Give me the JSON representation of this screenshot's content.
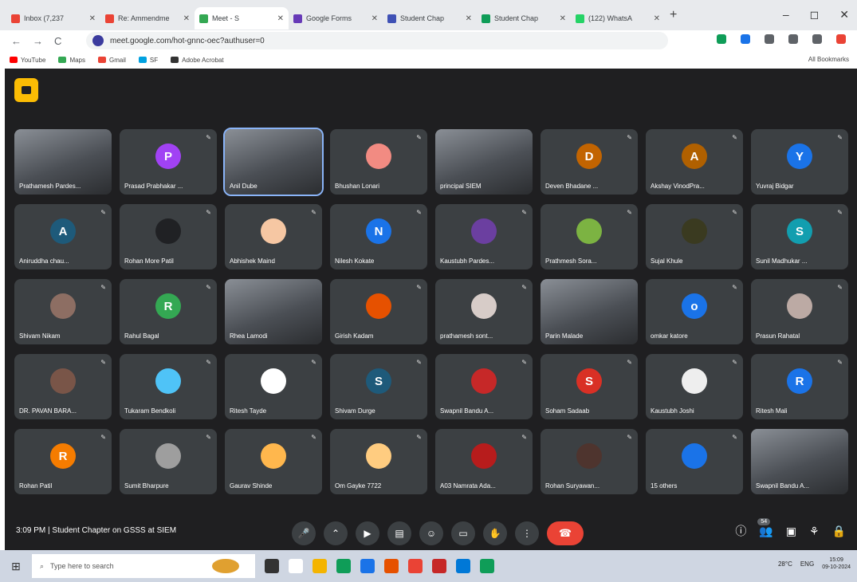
{
  "browser": {
    "tabs": [
      {
        "label": "Inbox (7,237",
        "icon_color": "#ea4335",
        "active": false
      },
      {
        "label": "Re: Ammendme",
        "icon_color": "#ea4335",
        "active": false
      },
      {
        "label": "Meet - S",
        "icon_color": "#34a853",
        "active": true
      },
      {
        "label": "Google Forms",
        "icon_color": "#673ab7",
        "active": false
      },
      {
        "label": "Student Chap",
        "icon_color": "#3f51b5",
        "active": false
      },
      {
        "label": "Student Chap",
        "icon_color": "#0f9d58",
        "active": false
      },
      {
        "label": "(122) WhatsA",
        "icon_color": "#25d366",
        "active": false
      }
    ],
    "new_tab": "+",
    "window_controls": [
      "–",
      "◻",
      "✕"
    ],
    "url": "meet.google.com/hot-gnnc-oec?authuser=0",
    "nav": {
      "back": "←",
      "forward": "→",
      "reload": "C"
    },
    "bookmarks": [
      {
        "label": "YouTube",
        "color": "#ff0000"
      },
      {
        "label": "Maps",
        "color": "#34a853"
      },
      {
        "label": "Gmail",
        "color": "#ea4335"
      },
      {
        "label": "SF",
        "color": "#00a1e0"
      },
      {
        "label": "Adobe Acrobat",
        "color": "#333333"
      }
    ],
    "all_bookmarks": "All Bookmarks",
    "extension_colors": [
      "#0f9d58",
      "#1a73e8",
      "#5f6368",
      "#5f6368",
      "#5f6368",
      "#ea4335"
    ]
  },
  "meet": {
    "participants": [
      {
        "name": "Prathamesh Pardes...",
        "avatar": "",
        "color": "",
        "video": true
      },
      {
        "name": "Prasad Prabhakar ...",
        "avatar": "P",
        "color": "#a142f4",
        "video": false
      },
      {
        "name": "Anil Dube",
        "avatar": "",
        "color": "",
        "video": true,
        "highlight": true
      },
      {
        "name": "Bhushan Lonari",
        "avatar": "",
        "color": "#f28b82",
        "video": false
      },
      {
        "name": "principal SIEM",
        "avatar": "",
        "color": "",
        "video": true
      },
      {
        "name": "Deven Bhadane ...",
        "avatar": "D",
        "color": "#c26401",
        "video": false
      },
      {
        "name": "Akshay VinodPra...",
        "avatar": "A",
        "color": "#b06000",
        "video": false
      },
      {
        "name": "Yuvraj Bidgar",
        "avatar": "Y",
        "color": "#1a73e8",
        "video": false
      },
      {
        "name": "Aniruddha chau...",
        "avatar": "A",
        "color": "#1e5a7a",
        "video": false
      },
      {
        "name": "Rohan More Patil",
        "avatar": "",
        "color": "#202124",
        "video": false
      },
      {
        "name": "Abhishek Maind",
        "avatar": "",
        "color": "#f6c7a3",
        "video": false
      },
      {
        "name": "Nilesh Kokate",
        "avatar": "N",
        "color": "#1a73e8",
        "video": false
      },
      {
        "name": "Kaustubh Pardes...",
        "avatar": "",
        "color": "#6b3fa0",
        "video": false
      },
      {
        "name": "Prathmesh Sora...",
        "avatar": "",
        "color": "#7cb342",
        "video": false
      },
      {
        "name": "Sujal Khule",
        "avatar": "",
        "color": "#3a3a20",
        "video": false
      },
      {
        "name": "Sunil Madhukar ...",
        "avatar": "S",
        "color": "#129eaf",
        "video": false
      },
      {
        "name": "Shivam Nikam",
        "avatar": "",
        "color": "#8d6e63",
        "video": false
      },
      {
        "name": "Rahul Bagal",
        "avatar": "R",
        "color": "#34a853",
        "video": false
      },
      {
        "name": "Rhea Lamodi",
        "avatar": "",
        "color": "",
        "video": true
      },
      {
        "name": "Girish Kadam",
        "avatar": "",
        "color": "#e65100",
        "video": false
      },
      {
        "name": "prathamesh sont...",
        "avatar": "",
        "color": "#d7ccc8",
        "video": false
      },
      {
        "name": "Parin Malade",
        "avatar": "",
        "color": "",
        "video": true
      },
      {
        "name": "omkar katore",
        "avatar": "o",
        "color": "#1a73e8",
        "video": false
      },
      {
        "name": "Prasun Rahatal",
        "avatar": "",
        "color": "#bcaaa4",
        "video": false
      },
      {
        "name": "DR. PAVAN BARA...",
        "avatar": "",
        "color": "#795548",
        "video": false
      },
      {
        "name": "Tukaram Bendkoli",
        "avatar": "",
        "color": "#4fc3f7",
        "video": false
      },
      {
        "name": "Ritesh Tayde",
        "avatar": "",
        "color": "#ffffff",
        "video": false
      },
      {
        "name": "Shivam Durge",
        "avatar": "S",
        "color": "#1e5a7a",
        "video": false
      },
      {
        "name": "Swapnil Bandu A...",
        "avatar": "",
        "color": "#c62828",
        "video": false
      },
      {
        "name": "Soham Sadaab",
        "avatar": "S",
        "color": "#d93025",
        "video": false
      },
      {
        "name": "Kaustubh Joshi",
        "avatar": "",
        "color": "#eeeeee",
        "video": false
      },
      {
        "name": "Ritesh Mali",
        "avatar": "R",
        "color": "#1a73e8",
        "video": false
      },
      {
        "name": "Rohan Patil",
        "avatar": "R",
        "color": "#f57c00",
        "video": false
      },
      {
        "name": "Sumit Bharpure",
        "avatar": "",
        "color": "#9e9e9e",
        "video": false
      },
      {
        "name": "Gaurav Shinde",
        "avatar": "",
        "color": "#ffb74d",
        "video": false
      },
      {
        "name": "Om Gayke 7722",
        "avatar": "",
        "color": "#ffcc80",
        "video": false
      },
      {
        "name": "A03 Namrata Ada...",
        "avatar": "",
        "color": "#b71c1c",
        "video": false
      },
      {
        "name": "Rohan Suryawan...",
        "avatar": "",
        "color": "#4e342e",
        "video": false
      },
      {
        "name": "15 others",
        "avatar": "",
        "color": "#1a73e8",
        "video": false
      },
      {
        "name": "Swapnil Bandu A...",
        "avatar": "",
        "color": "",
        "video": true
      }
    ],
    "mic_glyph": "✎",
    "bottom": {
      "time": "3:09 PM",
      "separator": "|",
      "meeting_title": "Student Chapter on GSSS at SIEM",
      "controls": [
        "🎤",
        "⌃",
        "▶",
        "▤",
        "☺",
        "▭",
        "✋",
        "⋮"
      ],
      "end_call": "☎",
      "right_controls": [
        "ⓘ",
        "👥",
        "▣",
        "⚘",
        "🔒"
      ],
      "participant_count": "54"
    }
  },
  "taskbar": {
    "start": "⊞",
    "search_placeholder": "Type here to search",
    "search_icon": "⌕",
    "app_icon_colors": [
      "#333333",
      "#ffffff",
      "#f4b400",
      "#0f9d58",
      "#1a73e8",
      "#e65100",
      "#ea4335",
      "#c62828",
      "#0078d7",
      "#0f9d58"
    ],
    "weather": "28°C",
    "tray_lang": "ENG",
    "clock_time": "15:09",
    "clock_date": "09-10-2024"
  }
}
